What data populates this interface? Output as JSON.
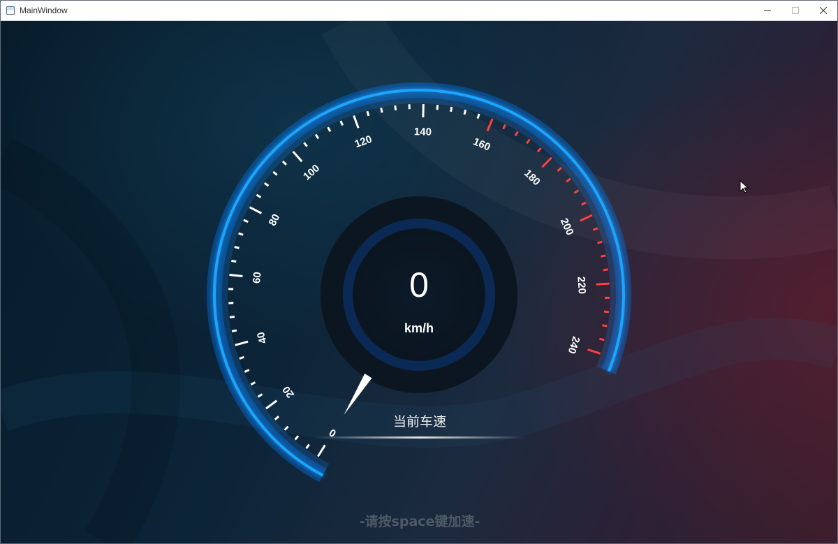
{
  "window": {
    "title": "MainWindow",
    "controls": {
      "minimize_icon": "minimize-icon",
      "maximize_icon": "maximize-icon",
      "close_icon": "close-icon"
    }
  },
  "speedometer": {
    "min": 0,
    "max": 240,
    "major_step": 20,
    "minor_divisions": 5,
    "redline_from": 160,
    "current_speed": "0",
    "unit": "km/h",
    "tick_labels": [
      "0",
      "20",
      "40",
      "60",
      "80",
      "100",
      "120",
      "140",
      "160",
      "180",
      "200",
      "220",
      "240"
    ],
    "colors": {
      "arc": "#1aa4ff",
      "ticks": "#ffffff",
      "redline": "#ff4040",
      "needle": "#ffffff"
    }
  },
  "caption": "当前车速",
  "hint": "-请按space键加速-"
}
